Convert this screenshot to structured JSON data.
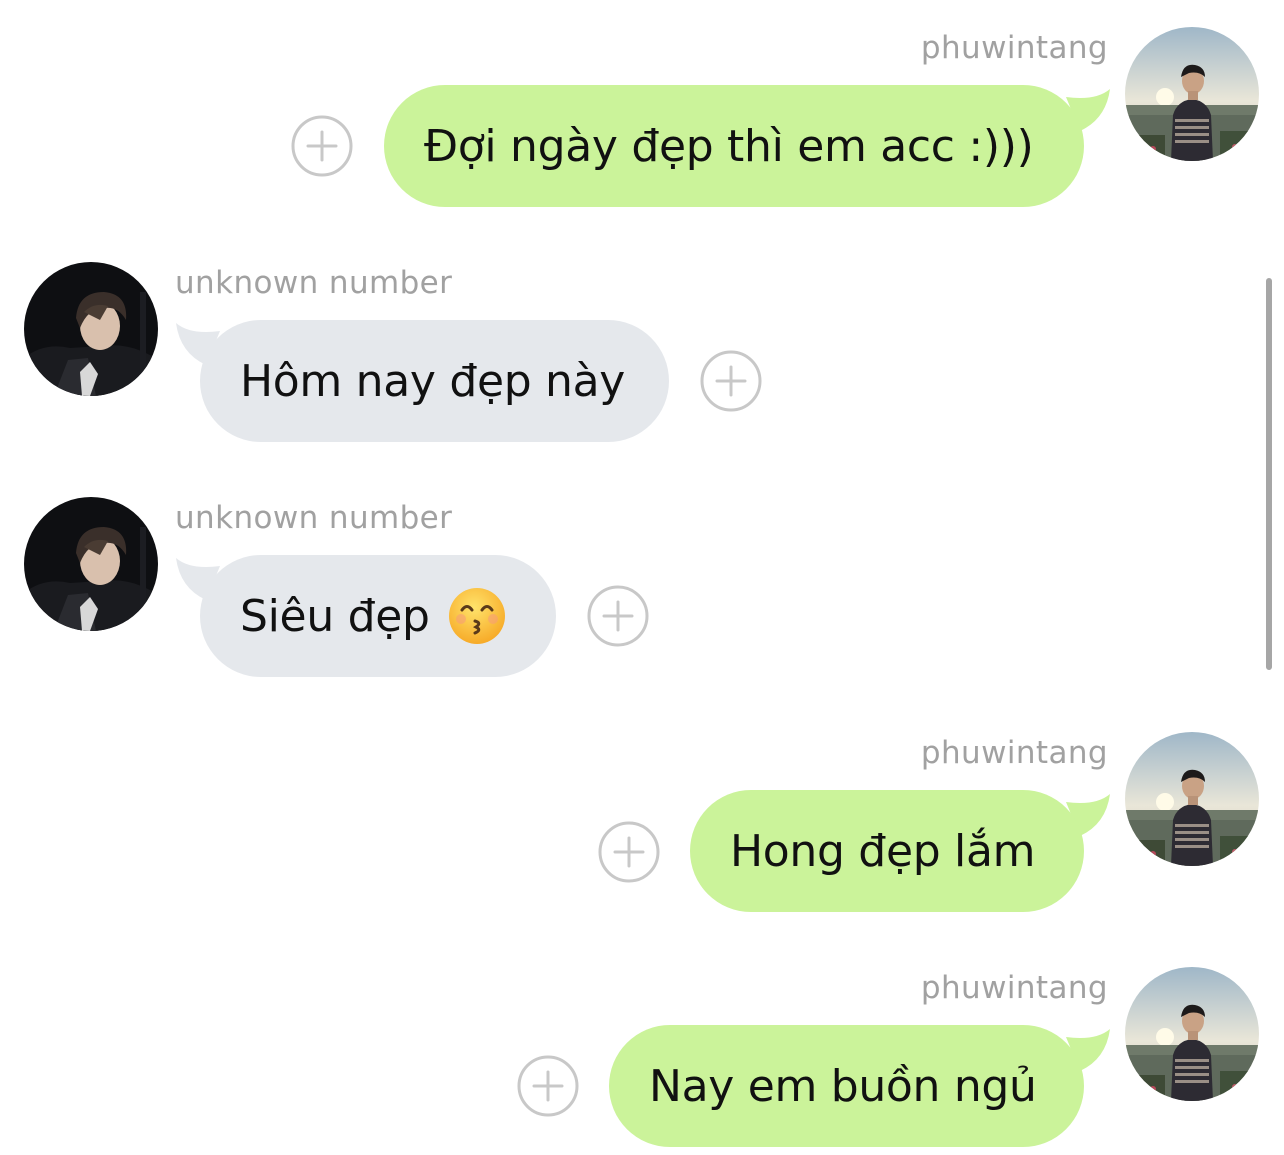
{
  "conversation": {
    "messages": [
      {
        "sender": "phuwintang",
        "direction": "outgoing",
        "text": "Đợi ngày đẹp thì em acc :)))"
      },
      {
        "sender": "unknown number",
        "direction": "incoming",
        "text": "Hôm nay đẹp này"
      },
      {
        "sender": "unknown number",
        "direction": "incoming",
        "text": "Siêu đẹp",
        "emoji": "kissing-face-with-smiling-eyes-emoji"
      },
      {
        "sender": "phuwintang",
        "direction": "outgoing",
        "text": "Hong đẹp lắm"
      },
      {
        "sender": "phuwintang",
        "direction": "outgoing",
        "text": "Nay em buồn ngủ"
      }
    ]
  },
  "icons": {
    "add_reaction": "add-reaction-icon",
    "outgoing_avatar": "avatar-photo",
    "incoming_avatar": "avatar-photo"
  },
  "colors": {
    "outgoing_bubble": "#cbf39a",
    "incoming_bubble": "#e5e8ec",
    "sender_label": "#a1a1a1",
    "text": "#111111",
    "reaction_icon": "#c8c8c8"
  }
}
